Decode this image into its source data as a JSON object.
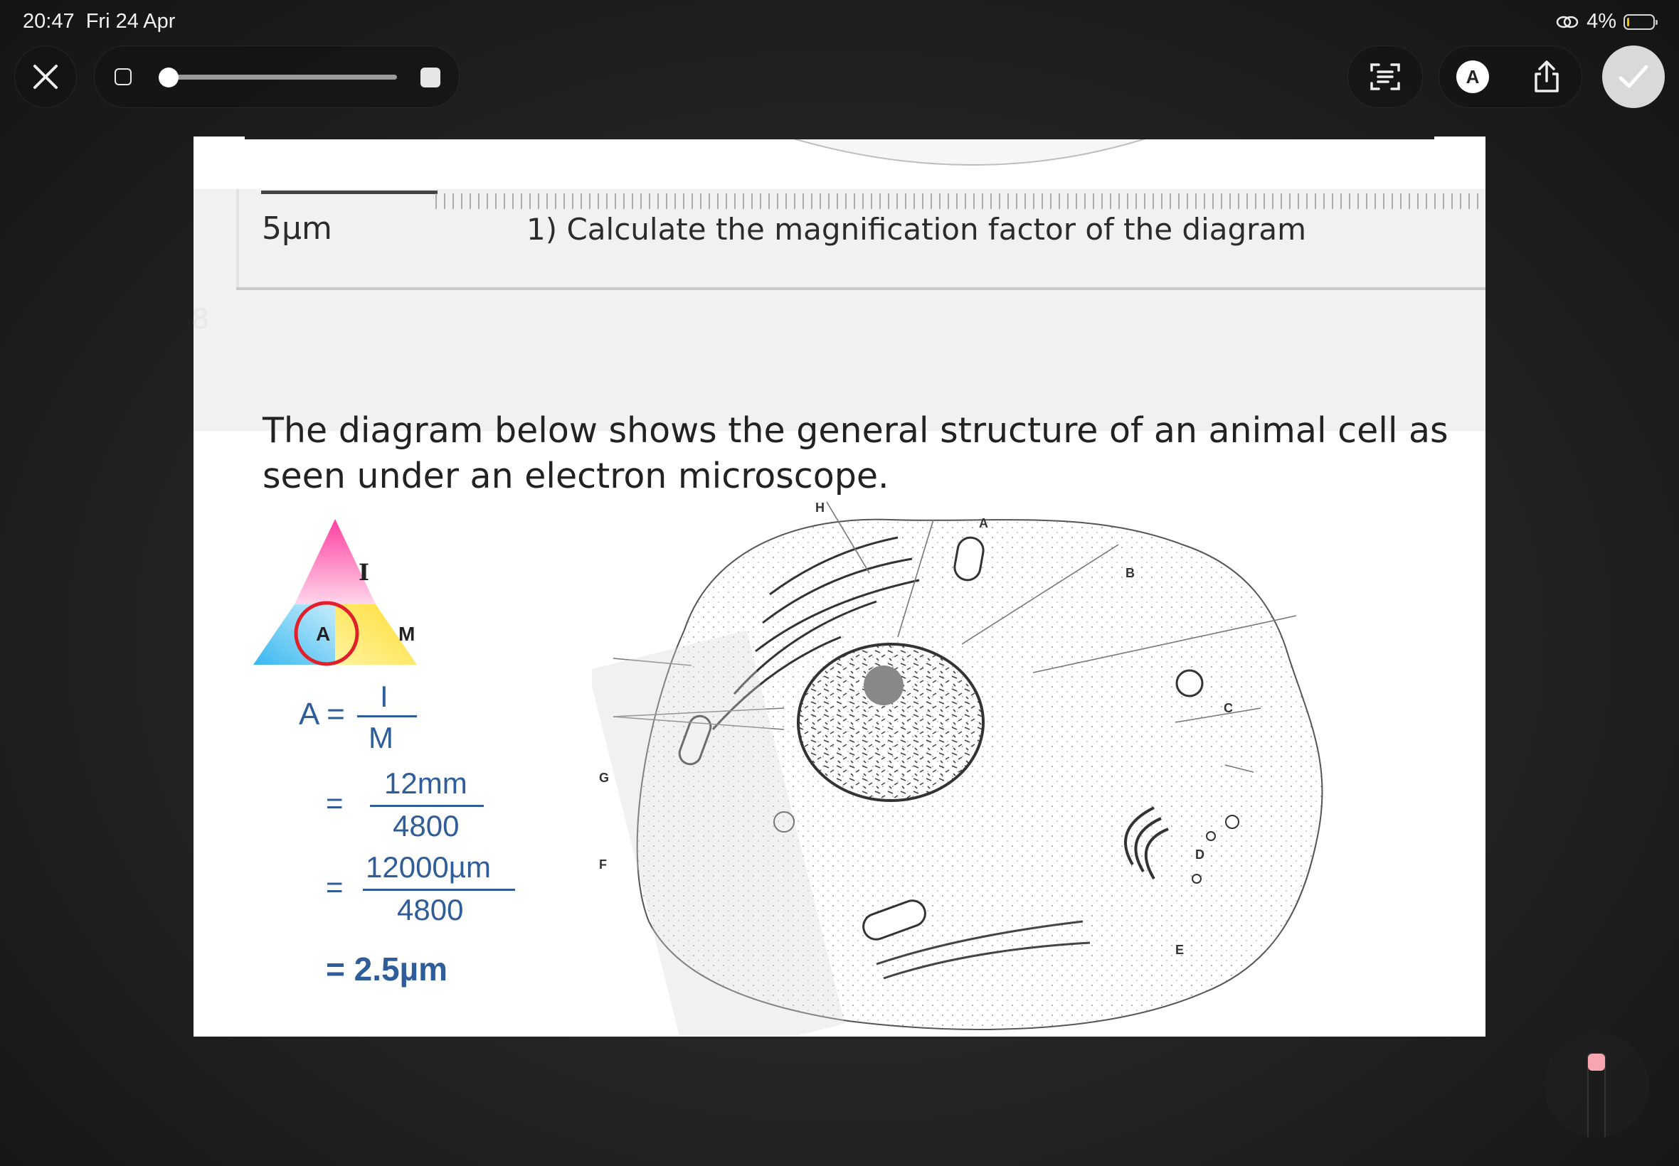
{
  "status_bar": {
    "time": "20:47",
    "date": "Fri 24 Apr",
    "battery": "4%"
  },
  "toolbar": {
    "close_icon": "close-icon",
    "markup_glyph": "A",
    "done_icon": "checkmark-icon"
  },
  "document": {
    "scale_label": "5µm",
    "question": "1) Calculate the magnification factor of the diagram",
    "page_number": "8",
    "intro": "The diagram below shows the general structure of an animal cell as seen under an electron microscope.",
    "triangle": {
      "top": "I",
      "left": "A",
      "right": "M"
    },
    "formula": {
      "lhs": "A =",
      "num1": "I",
      "den1": "M",
      "eq2": "=",
      "num2": "12mm",
      "den2": "4800",
      "eq3": "=",
      "num3": "12000µm",
      "den3": "4800",
      "result": "= 2.5µm"
    },
    "cell_labels": {
      "H": "H",
      "A": "A",
      "B": "B",
      "C": "C",
      "G": "G",
      "F": "F",
      "D": "D",
      "E": "E"
    }
  },
  "colors": {
    "formula_blue": "#2f5d9a",
    "triangle_pink": "#ff5fae",
    "triangle_cyan": "#3fc2f0",
    "triangle_yellow": "#ffe14d",
    "circle_red": "#e0202a"
  }
}
